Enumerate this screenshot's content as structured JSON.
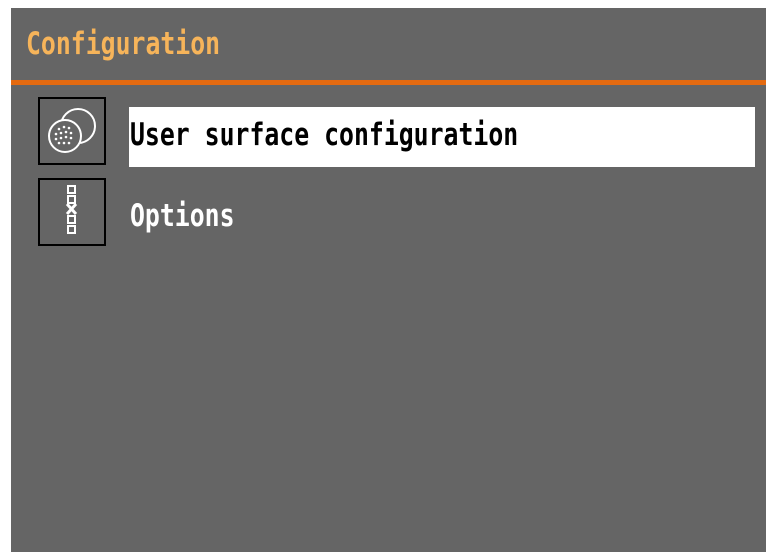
{
  "screen": {
    "title": "Configuration"
  },
  "menu": {
    "items": [
      {
        "label": "User surface configuration",
        "icon": "user-surface-icon",
        "selected": true
      },
      {
        "label": "Options",
        "icon": "options-icon",
        "selected": false
      }
    ]
  },
  "colors": {
    "background": "#656565",
    "title": "#f6b45a",
    "accent_rule": "#e46a10",
    "selection": "#ffffff"
  }
}
